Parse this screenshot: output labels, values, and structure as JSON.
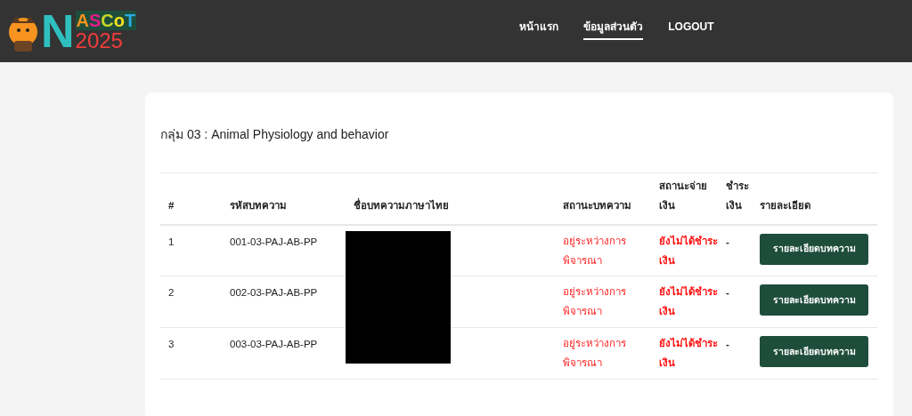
{
  "logo": {
    "initial": "N",
    "letters": [
      {
        "text": "A",
        "color": "#f7931e"
      },
      {
        "text": "S",
        "color": "#e6198c"
      },
      {
        "text": "C",
        "color": "#c8d62b"
      },
      {
        "text": "o",
        "color": "#f5e11e"
      },
      {
        "text": "T",
        "color": "#29a9e0"
      }
    ],
    "year": "2025"
  },
  "nav": [
    {
      "label": "หน้าแรก",
      "selected": false
    },
    {
      "label": "ข้อมูลส่วนตัว",
      "selected": true
    },
    {
      "label": "LOGOUT",
      "selected": false
    }
  ],
  "group_title": "กลุ่ม 03 : Animal Physiology and behavior",
  "table": {
    "columns": [
      "#",
      "รหัสบทความ",
      "ชื่อบทความภาษาไทย",
      "สถานะบทความ",
      "สถานะจ่ายเงิน",
      "ชำระเงิน",
      "รายละเอียด"
    ],
    "rows": [
      {
        "number": "1",
        "code": "001-03-PAJ-AB-PP",
        "status": "อยู่ระหว่างการพิจารณา",
        "payment_status": "ยังไม่ได้ชำระเงิน",
        "payment": "-",
        "button": "รายละเอียดบทความ"
      },
      {
        "number": "2",
        "code": "002-03-PAJ-AB-PP",
        "status": "อยู่ระหว่างการพิจารณา",
        "payment_status": "ยังไม่ได้ชำระเงิน",
        "payment": "-",
        "button": "รายละเอียดบทความ"
      },
      {
        "number": "3",
        "code": "003-03-PAJ-AB-PP",
        "status": "อยู่ระหว่างการพิจารณา",
        "payment_status": "ยังไม่ได้ชำระเงิน",
        "payment": "-",
        "button": "รายละเอียดบทความ"
      }
    ]
  }
}
